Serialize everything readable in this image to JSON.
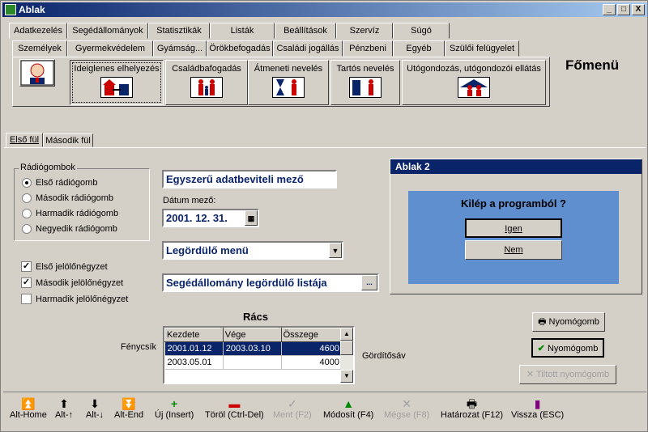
{
  "window": {
    "title": "Ablak",
    "minimize": "_",
    "maximize": "□",
    "close": "X"
  },
  "menu_tabs_row1": [
    "Adatkezelés",
    "Segédállományok",
    "Statisztikák",
    "Listák",
    "Beállítások",
    "Szervíz",
    "Súgó"
  ],
  "menu_tabs_row2": [
    "Személyek",
    "Gyermekvédelem",
    "Gyámság...",
    "Örökbefogadás",
    "Családi jogállás",
    "Pénzbeni",
    "Egyéb",
    "Szülői felügyelet"
  ],
  "big_buttons": [
    "Ideiglenes elhelyezés",
    "Családbafogadás",
    "Átmeneti nevelés",
    "Tartós nevelés",
    "Utógondozás, utógondozói ellátás"
  ],
  "main_menu_title": "Főmenü",
  "form_tabs": [
    "Első fül",
    "Második fül"
  ],
  "radio_group": {
    "label": "Rádiógombok",
    "options": [
      "Első rádiógomb",
      "Második rádiógomb",
      "Harmadik rádiógomb",
      "Negyedik rádiógomb"
    ],
    "selected": 0
  },
  "checkboxes": [
    {
      "label": "Első jelölőnégyzet",
      "checked": true
    },
    {
      "label": "Második jelölőnégyzet",
      "checked": true
    },
    {
      "label": "Harmadik jelölőnégyzet",
      "checked": false
    }
  ],
  "simple_input": {
    "value": "Egyszerű adatbeviteli mező"
  },
  "date_field": {
    "label": "Dátum mező:",
    "value": "2001. 12. 31."
  },
  "dropdown": {
    "value": "Legördülő menü"
  },
  "aux_dropdown": {
    "value": "Segédállomány legördülő listája",
    "button": "..."
  },
  "dialog": {
    "title": "Ablak 2",
    "question": "Kilép a programból ?",
    "yes": "Igen",
    "no": "Nem"
  },
  "grid": {
    "title": "Rács",
    "row_label": "Fénycsík",
    "scroll_label": "Gördítősáv",
    "columns": [
      "Kezdete",
      "Vége",
      "Összege"
    ],
    "rows": [
      [
        "2001.01.12",
        "2003.03.10",
        "4600"
      ],
      [
        "2003.05.01",
        "",
        "4000"
      ]
    ]
  },
  "right_buttons": {
    "print": "Nyomógomb",
    "ok": "Nyomógomb",
    "disabled": "Tiltott nyomógomb"
  },
  "toolbar": [
    "Alt-Home",
    "Alt-↑",
    "Alt-↓",
    "Alt-End",
    "Új (Insert)",
    "Töröl (Ctrl-Del)",
    "Ment (F2)",
    "Módosít (F4)",
    "Mégse (F8)",
    "Határozat (F12)",
    "Vissza (ESC)"
  ]
}
